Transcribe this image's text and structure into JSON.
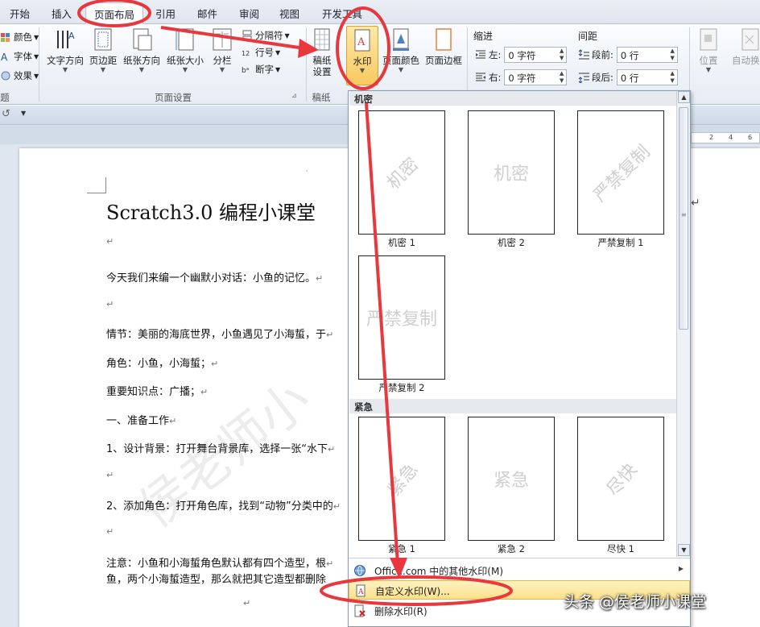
{
  "tabs": [
    "开始",
    "插入",
    "页面布局",
    "引用",
    "邮件",
    "审阅",
    "视图",
    "开发工具"
  ],
  "ribbon": {
    "theme_items": [
      "颜色",
      "字体",
      "效果"
    ],
    "theme_group_tail": "题",
    "page_setup": {
      "buttons": [
        "文字方向",
        "页边距",
        "纸张方向",
        "纸张大小",
        "分栏"
      ],
      "small": [
        "分隔符",
        "行号",
        "断字"
      ],
      "group_label": "页面设置"
    },
    "manuscript": {
      "button_line1": "稿纸",
      "button_line2": "设置",
      "group_label": "稿纸"
    },
    "watermark_button": "水印",
    "page_color": "页面颜色",
    "page_border": "页面边框",
    "indent": {
      "title": "缩进",
      "left_label": "左:",
      "left_value": "0 字符",
      "right_label": "右:",
      "right_value": "0 字符"
    },
    "spacing": {
      "title": "间距",
      "before_label": "段前:",
      "before_value": "0 行",
      "after_label": "段后:",
      "after_value": "0 行"
    },
    "arrange": [
      "位置",
      "自动换行"
    ]
  },
  "ruler_ticks": [
    "2",
    "4",
    "6"
  ],
  "document": {
    "title": "Scratch3.0 编程小课堂",
    "paragraphs": [
      "今天我们来编一个幽默小对话：小鱼的记忆。",
      "",
      "情节：美丽的海底世界，小鱼遇见了小海蜇，于",
      "角色：小鱼，小海蜇；",
      "重要知识点：广播；",
      "一、准备工作",
      "1、设计背景：打开舞台背景库，选择一张“水下",
      "",
      "2、添加角色：打开角色库，找到“动物”分类中的",
      "",
      "注意：小鱼和小海蜇角色默认都有四个造型，根",
      "鱼，两个小海蜇造型，那么就把其它造型都删除"
    ],
    "para_mark": "↵",
    "bg_watermark": "侯老师小"
  },
  "gallery": {
    "section1": "机密",
    "section2": "紧急",
    "items": [
      {
        "caption": "机密 1",
        "text": "机密"
      },
      {
        "caption": "机密 2",
        "text": "机密"
      },
      {
        "caption": "严禁复制 1",
        "text": "严禁复制"
      },
      {
        "caption": "严禁复制 2",
        "text": "严禁复制"
      },
      {
        "caption": "紧急 1",
        "text": "紧急"
      },
      {
        "caption": "紧急 2",
        "text": "紧急"
      },
      {
        "caption": "尽快 1",
        "text": "尽快"
      }
    ]
  },
  "menu": {
    "office_more": "Office.com 中的其他水印(M)",
    "custom": "自定义水印(W)...",
    "remove": "删除水印(R)"
  },
  "credit": "头条 @侯老师小课堂",
  "colors": {
    "annotation": "#e8383d",
    "highlight": "#fbe08a",
    "ribbon_bg": "#e6ecf4"
  }
}
